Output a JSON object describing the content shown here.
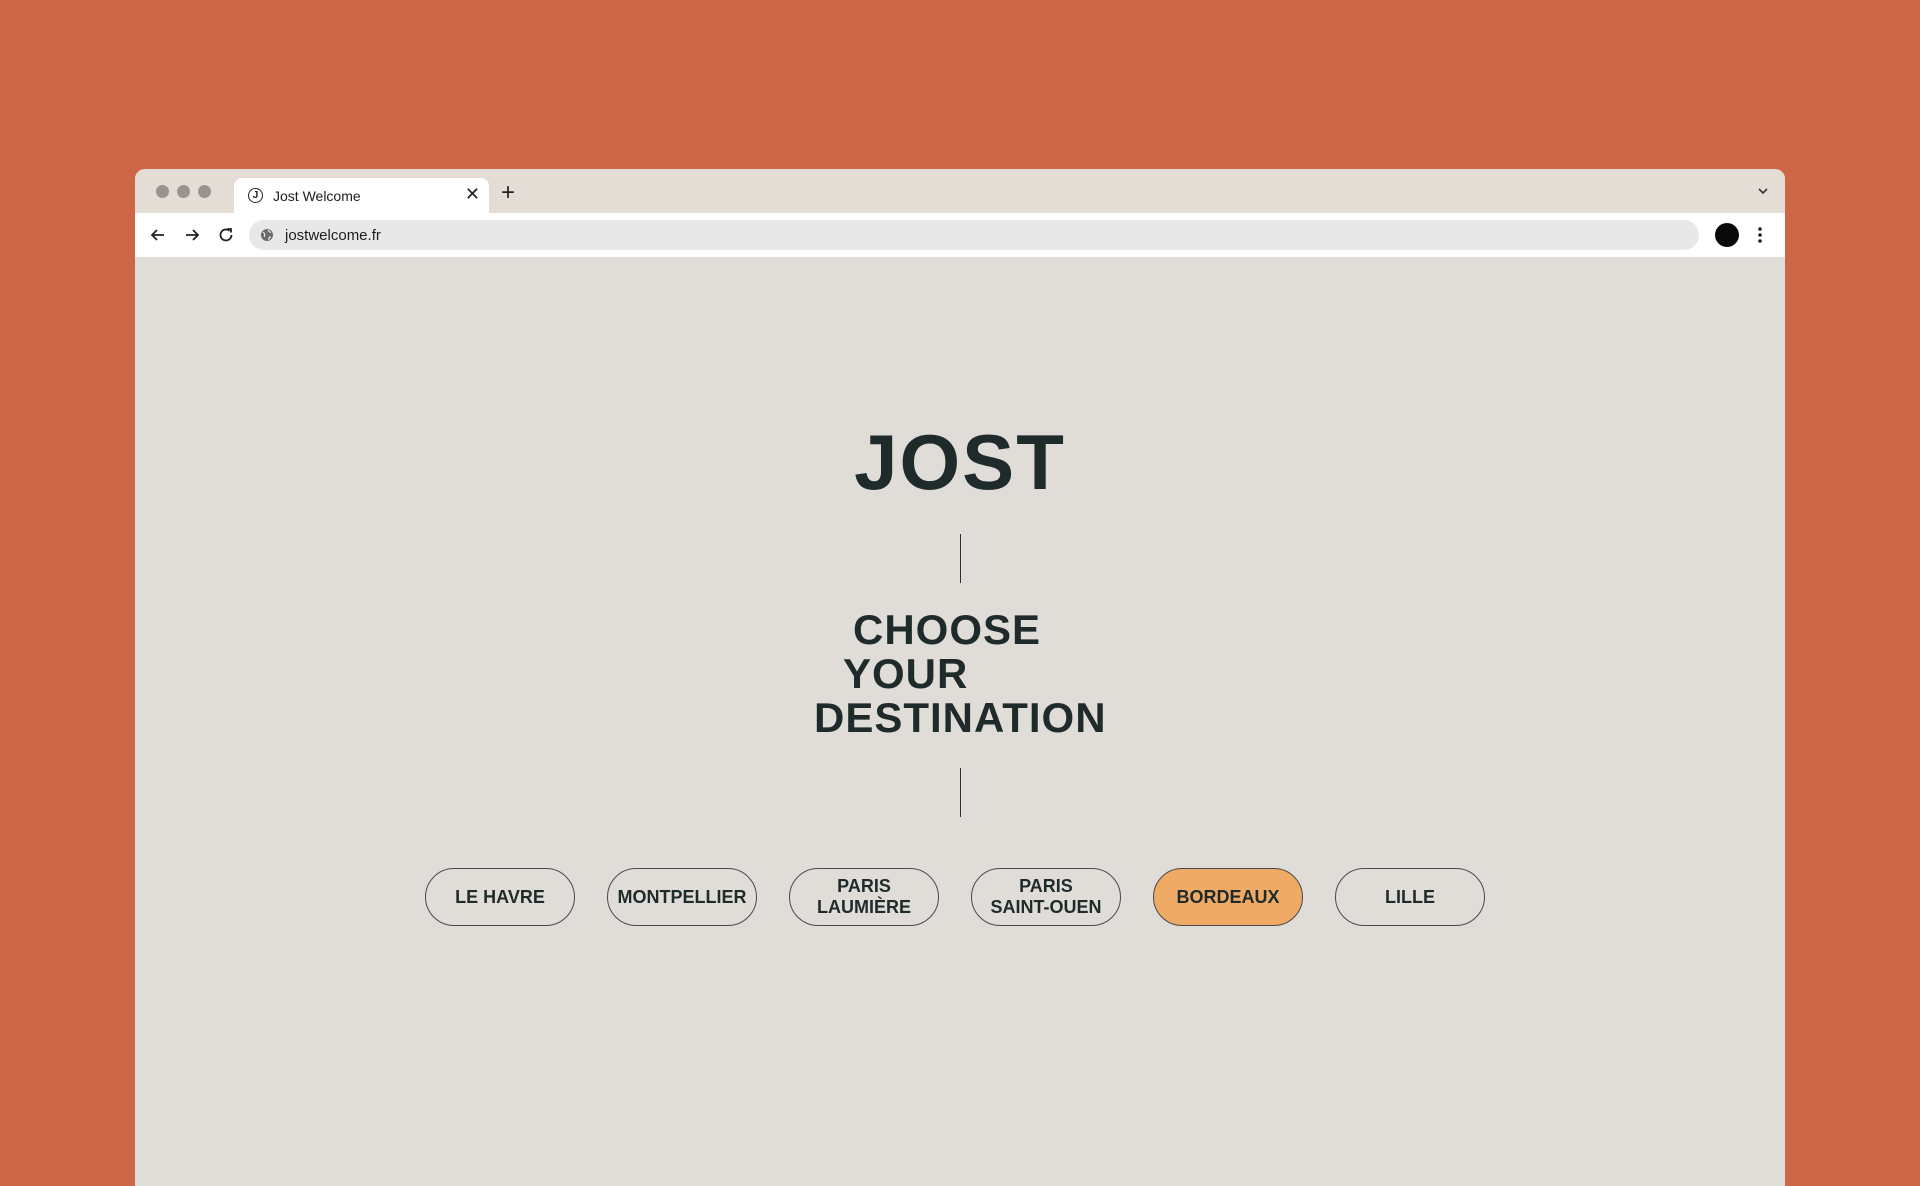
{
  "browser": {
    "tab": {
      "title": "Jost Welcome",
      "favicon_letter": "J"
    },
    "address": {
      "url": "jostwelcome.fr"
    },
    "icons": [
      "back-arrow-icon",
      "forward-arrow-icon",
      "reload-icon",
      "globe-icon",
      "close-icon",
      "plus-icon",
      "chevron-down-icon",
      "kebab-menu-icon"
    ]
  },
  "page": {
    "logo": "JOST",
    "heading": {
      "line1": "CHOOSE",
      "line2": "YOUR",
      "line3": "DESTINATION"
    },
    "destinations": [
      {
        "label": "LE HAVRE",
        "selected": false
      },
      {
        "label": "MONTPELLIER",
        "selected": false
      },
      {
        "label": "PARIS\nLAUMIÈRE",
        "selected": false
      },
      {
        "label": "PARIS\nSAINT-OUEN",
        "selected": false
      },
      {
        "label": "BORDEAUX",
        "selected": true
      },
      {
        "label": "LILLE",
        "selected": false
      }
    ]
  },
  "colors": {
    "backdrop": "#cd6646",
    "page_bg": "#e0dcd7",
    "text": "#1f2b2b",
    "accent": "#efab66"
  }
}
